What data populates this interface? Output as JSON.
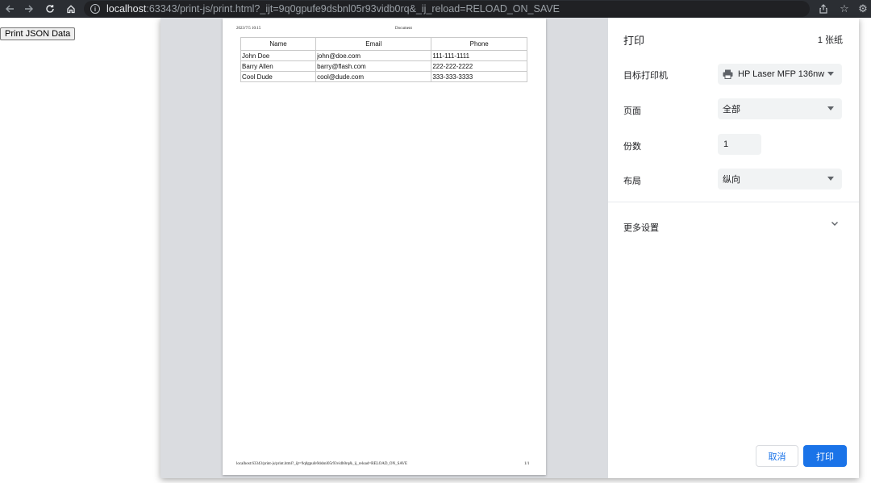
{
  "browser": {
    "url_host": "localhost",
    "url_rest": ":63343/print-js/print.html?_ijt=9q0gpufe9dsbnl05r93vidb0rq&_ij_reload=RELOAD_ON_SAVE"
  },
  "page": {
    "print_button_label": "Print JSON Data"
  },
  "preview": {
    "header_date": "2023/7/5 10:15",
    "header_title": "Document",
    "footer_url": "localhost:63343/print-js/print.html?_ijt=9q0gpufe9dsbnl05r93vidb0rq&_ij_reload=RELOAD_ON_SAVE",
    "page_number": "1/1",
    "table": {
      "columns": [
        "Name",
        "Email",
        "Phone"
      ],
      "rows": [
        [
          "John Doe",
          "john@doe.com",
          "111-111-1111"
        ],
        [
          "Barry Allen",
          "barry@flash.com",
          "222-222-2222"
        ],
        [
          "Cool Dude",
          "cool@dude.com",
          "333-333-3333"
        ]
      ]
    }
  },
  "settings": {
    "title": "打印",
    "sheet_count": "1 张纸",
    "destination_label": "目标打印机",
    "destination_value": "HP Laser MFP 136nw",
    "pages_label": "页面",
    "pages_value": "全部",
    "copies_label": "份数",
    "copies_value": "1",
    "layout_label": "布局",
    "layout_value": "纵向",
    "more_settings_label": "更多设置",
    "cancel_label": "取消",
    "print_label": "打印"
  },
  "colors": {
    "accent": "#1a73e8",
    "toolbar_bg": "#2b2e33",
    "preview_bg": "#dadce0"
  }
}
